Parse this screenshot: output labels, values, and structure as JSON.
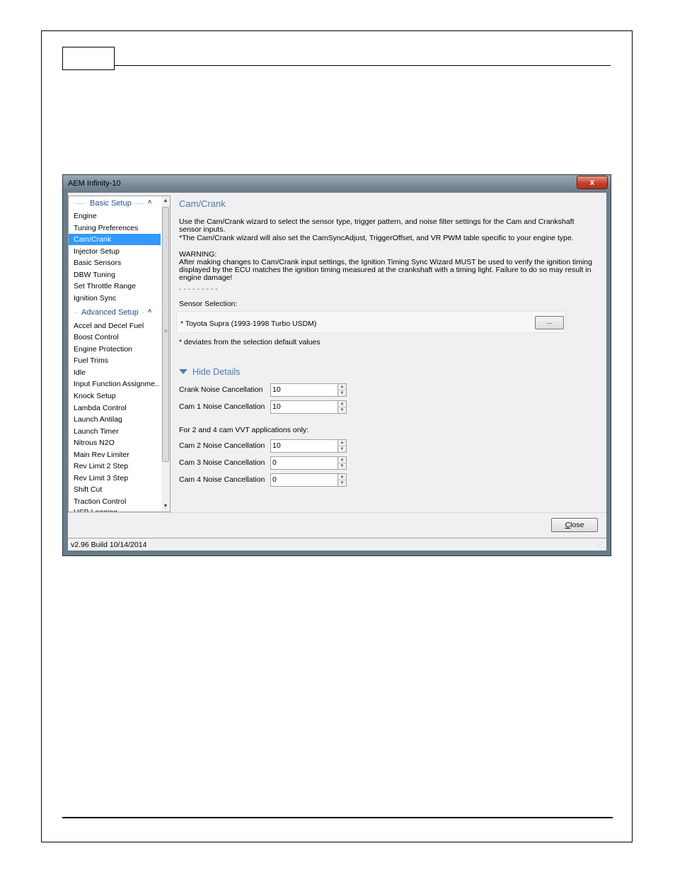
{
  "window": {
    "title": "AEM Infinity-10",
    "close_glyph": "x"
  },
  "sidebar": {
    "groups": [
      {
        "label": "Basic Setup",
        "chevron": "˄"
      },
      {
        "label": "Advanced Setup",
        "chevron": "˄"
      }
    ],
    "basic_items": [
      "Engine",
      "Tuning Preferences",
      "Cam/Crank",
      "Injector Setup",
      "Basic Sensors",
      "DBW Tuning",
      "Set Throttle Range",
      "Ignition Sync"
    ],
    "advanced_items": [
      "Accel and Decel Fuel",
      "Boost Control",
      "Engine Protection",
      "Fuel Trims",
      "Idle",
      "Input Function Assignme..",
      "Knock Setup",
      "Lambda Control",
      "Launch Antilag",
      "Launch Timer",
      "Nitrous N2O",
      "Main Rev Limiter",
      "Rev Limit 2 Step",
      "Rev Limit 3 Step",
      "Shift Cut",
      "Traction Control",
      "USB Logging"
    ],
    "selected": "Cam/Crank"
  },
  "content": {
    "title": "Cam/Crank",
    "intro1": "Use the Cam/Crank wizard to select the sensor type, trigger pattern, and noise filter settings for the Cam and Crankshaft sensor inputs.",
    "intro2": "*The Cam/Crank wizard will also set the CamSyncAdjust, TriggerOffset, and VR PWM table specific to your engine type.",
    "warning_label": "WARNING:",
    "warning_text": "After making changes to Cam/Crank input settings, the Ignition Timing Sync Wizard MUST be used to verify the ignition timing displayed by the ECU matches the ignition timing measured at the crankshaft with a timing light. Failure to do so may result in engine damage!",
    "dashes": "- - - - - - - - -",
    "sensor_selection_label": "Sensor Selection:",
    "sensor_value": "* Toyota Supra (1993-1998 Turbo USDM)",
    "browse_button": "...",
    "footnote": "* deviates from the selection default values",
    "hide_details": "Hide Details",
    "fields_a": [
      {
        "label": "Crank Noise Cancellation",
        "value": "10"
      },
      {
        "label": "Cam 1 Noise Cancellation",
        "value": "10"
      }
    ],
    "vvt_note": "For 2 and 4 cam VVT applications only:",
    "fields_b": [
      {
        "label": "Cam 2 Noise Cancellation",
        "value": "10"
      },
      {
        "label": "Cam 3 Noise Cancellation",
        "value": "0"
      },
      {
        "label": "Cam 4 Noise Cancellation",
        "value": "0"
      }
    ]
  },
  "footer": {
    "close_first": "C",
    "close_rest": "lose",
    "status": "v2.96 Build 10/14/2014"
  }
}
